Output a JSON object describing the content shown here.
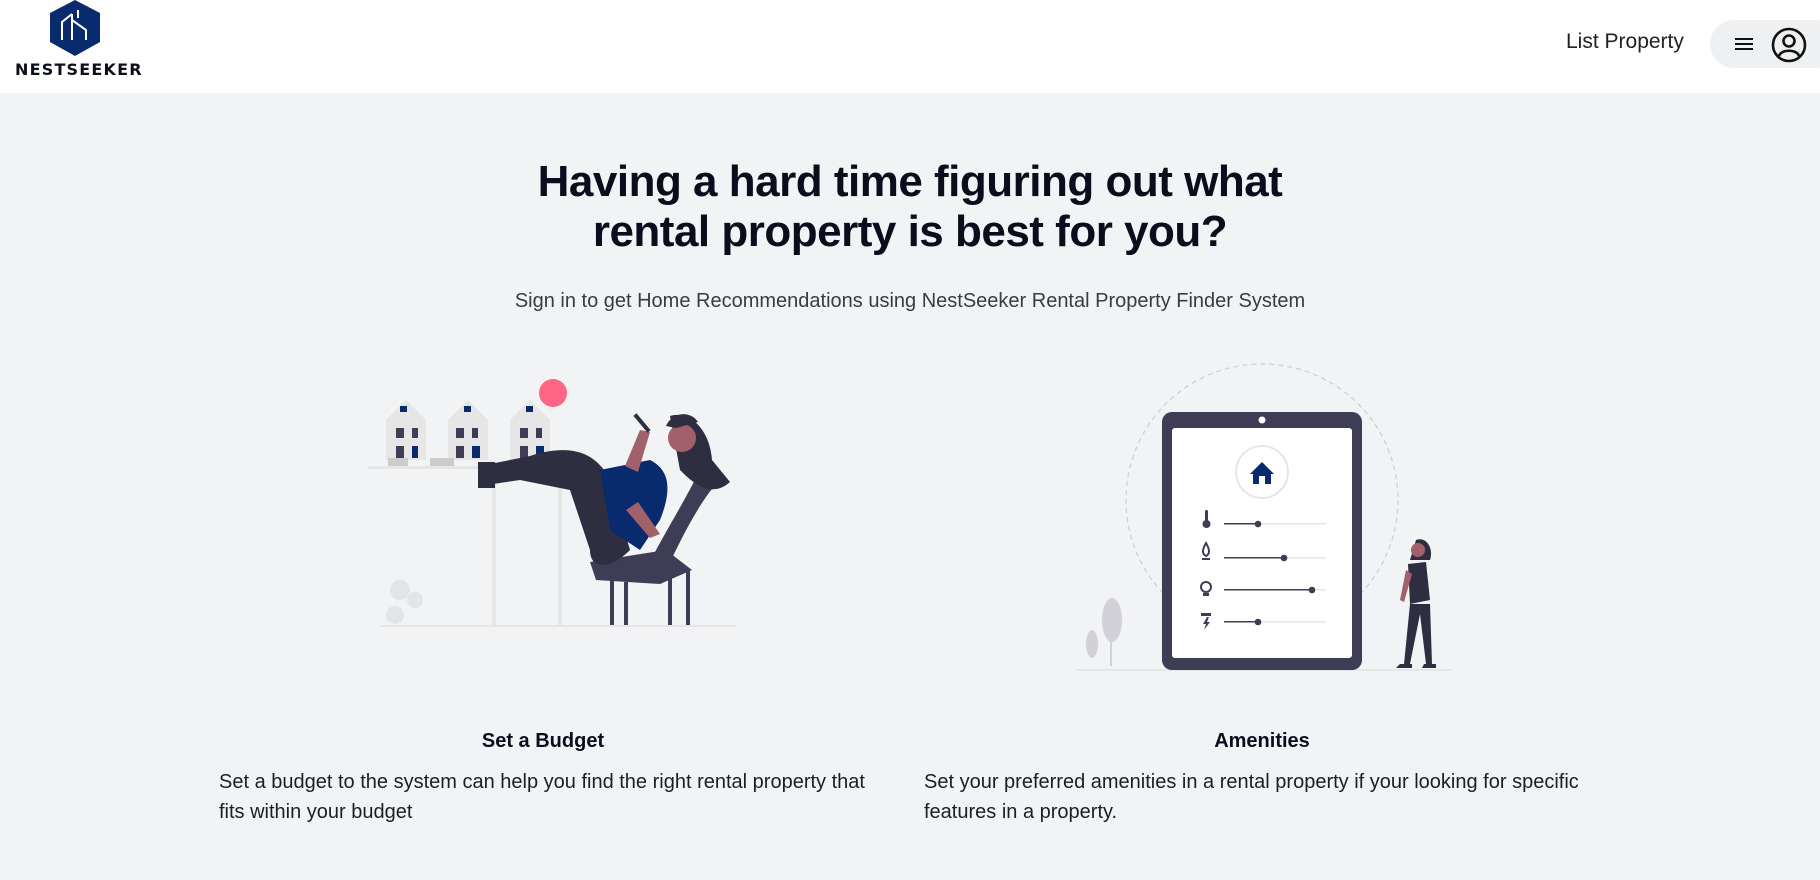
{
  "brand": {
    "name": "NESTSEEKER",
    "color": "#0a2a6e"
  },
  "header": {
    "list_property": "List Property",
    "menu_icon": "hamburger-menu-icon",
    "account_icon": "user-circle-icon"
  },
  "hero": {
    "title_line1": "Having a hard time figuring out what",
    "title_line2": "rental property is best for you?",
    "subtitle": "Sign in to get Home Recommendations using NestSeeker Rental Property Finder System"
  },
  "features": [
    {
      "title": "Set a Budget",
      "description": "Set a budget to the system can help you find the right rental property that fits within your budget",
      "illustration": "woman-relaxing-with-houses-illustration"
    },
    {
      "title": "Amenities",
      "description": "Set your preferred amenities in a rental property if your looking for specific features in a property.",
      "illustration": "tablet-amenity-sliders-illustration",
      "slider_icons": [
        "thermometer-icon",
        "water-drop-icon",
        "lightbulb-icon",
        "plug-icon"
      ],
      "slider_levels": [
        0.27,
        0.57,
        0.9,
        0.27
      ]
    }
  ],
  "colors": {
    "accent": "#0a2a6e",
    "dark": "#3f3d56",
    "pink": "#ff6584",
    "skin": "#a0616a"
  }
}
